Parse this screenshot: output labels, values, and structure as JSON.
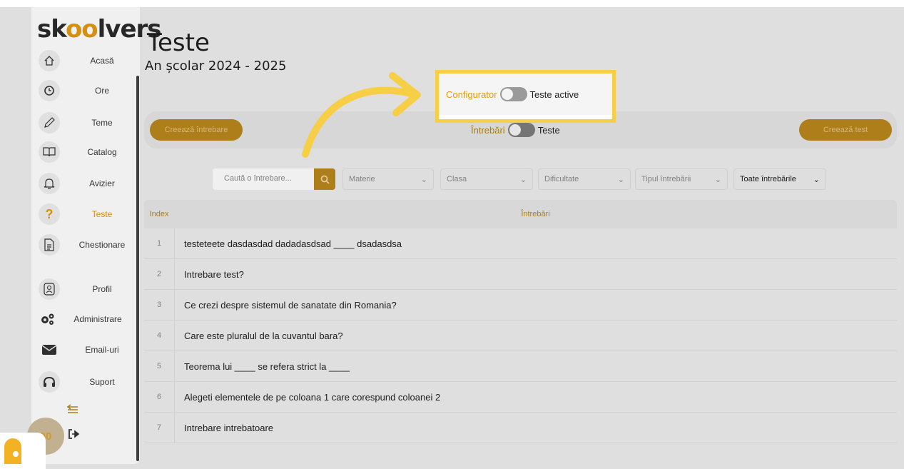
{
  "sidebar": {
    "logo": {
      "pre": "sk",
      "o": "oo",
      "post": "lvers"
    },
    "items": [
      {
        "label": "Acasă",
        "icon": "home-icon"
      },
      {
        "label": "Ore",
        "icon": "clock-icon"
      },
      {
        "label": "Teme",
        "icon": "pencil-icon"
      },
      {
        "label": "Catalog",
        "icon": "book-icon"
      },
      {
        "label": "Avizier",
        "icon": "bell-icon"
      },
      {
        "label": "Teste",
        "icon": "question-icon",
        "active": true
      },
      {
        "label": "Chestionare",
        "icon": "document-icon"
      },
      {
        "label": "Profil",
        "icon": "profile-icon"
      },
      {
        "label": "Administrare",
        "icon": "gears-icon"
      },
      {
        "label": "Email-uri",
        "icon": "envelope-icon"
      },
      {
        "label": "Suport",
        "icon": "headphones-icon"
      }
    ],
    "bubble_text": "00"
  },
  "header": {
    "title": "Teste",
    "subtitle": "An școlar 2024 - 2025"
  },
  "toolbar": {
    "create_question": "Creează întrebare",
    "toggle_left": "Întrebări",
    "toggle_right": "Teste",
    "create_test": "Creează test"
  },
  "highlight": {
    "toggle_left": "Configurator",
    "toggle_right": "Teste active"
  },
  "filters": {
    "search_placeholder": "Caută o întrebare...",
    "materie": "Materie",
    "clasa": "Clasa",
    "dificultate": "Dificultate",
    "tipul": "Tipul întrebării",
    "toate": "Toate întrebările"
  },
  "table": {
    "col_index": "Index",
    "col_question": "Întrebări",
    "rows": [
      {
        "index": "1",
        "question": "testeteete dasdasdad dadadasdsad ____ dsadasdsa"
      },
      {
        "index": "2",
        "question": "Intrebare test?"
      },
      {
        "index": "3",
        "question": "Ce crezi despre sistemul de sanatate din Romania?"
      },
      {
        "index": "4",
        "question": "Care este pluralul de la cuvantul bara?"
      },
      {
        "index": "5",
        "question": "Teorema lui ____ se refera strict la ____"
      },
      {
        "index": "6",
        "question": "Alegeti elementele de pe coloana 1 care corespund coloanei 2"
      },
      {
        "index": "7",
        "question": "Intrebare intrebatoare"
      }
    ]
  },
  "colors": {
    "accent": "#e39a13",
    "highlight_border": "#f7cf46",
    "button": "#b8861c"
  }
}
